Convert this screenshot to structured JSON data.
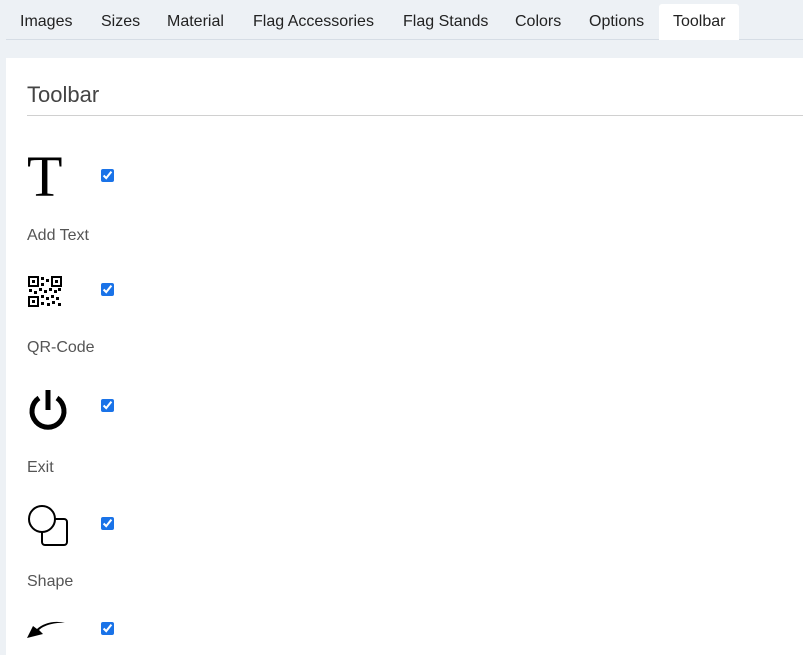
{
  "tabs": [
    {
      "label": "Images",
      "active": false
    },
    {
      "label": "Sizes",
      "active": false
    },
    {
      "label": "Material",
      "active": false
    },
    {
      "label": "Flag Accessories",
      "active": false
    },
    {
      "label": "Flag Stands",
      "active": false
    },
    {
      "label": "Colors",
      "active": false
    },
    {
      "label": "Options",
      "active": false
    },
    {
      "label": "Toolbar",
      "active": true
    }
  ],
  "panel": {
    "title": "Toolbar",
    "tools": [
      {
        "label": "Add Text",
        "icon": "text-icon",
        "glyph": "T",
        "checked": true
      },
      {
        "label": "QR-Code",
        "icon": "qr-code-icon",
        "checked": true
      },
      {
        "label": "Exit",
        "icon": "power-icon",
        "checked": true
      },
      {
        "label": "Shape",
        "icon": "shape-icon",
        "checked": true
      },
      {
        "label": "",
        "icon": "arrow-icon",
        "checked": true
      }
    ]
  },
  "colors": {
    "accent": "#1a73e8",
    "tab_bar_bg": "#edf1f5",
    "panel_bg": "#ffffff"
  }
}
